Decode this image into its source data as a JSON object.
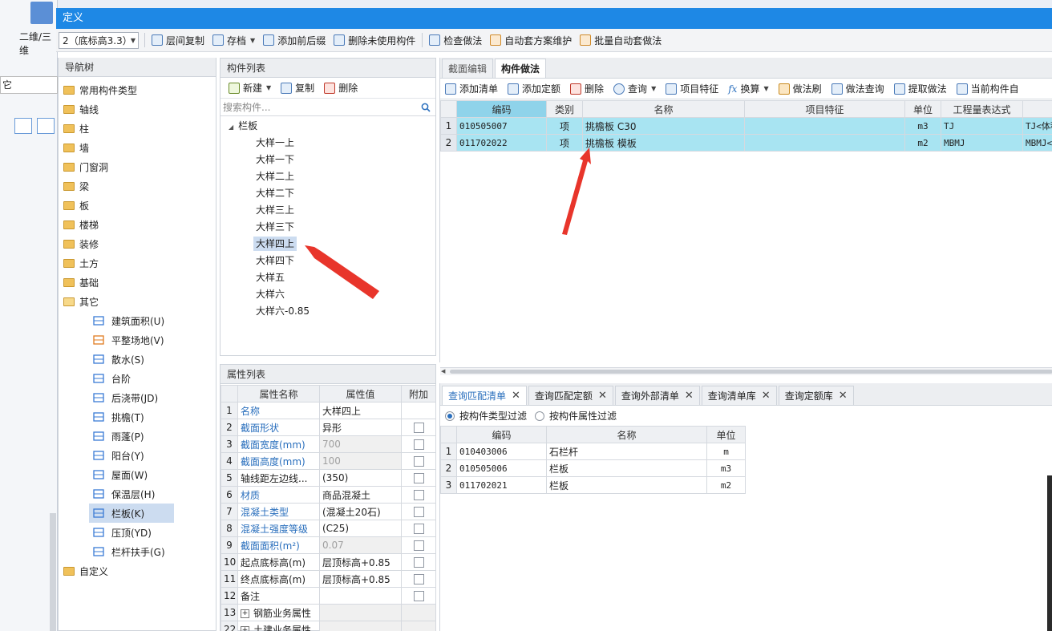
{
  "window": {
    "title": "定义"
  },
  "background_app": {
    "ribbon_label": "二维/三维",
    "left_combo": "它"
  },
  "toolbar": {
    "floor_select": "2（底标高3.3）",
    "items": [
      "层间复制",
      "存档",
      "添加前后缀",
      "删除未使用构件",
      "检查做法",
      "自动套方案维护",
      "批量自动套做法"
    ]
  },
  "nav_tree": {
    "title": "导航树",
    "items": [
      "常用构件类型",
      "轴线",
      "柱",
      "墙",
      "门窗洞",
      "梁",
      "板",
      "楼梯",
      "装修",
      "土方",
      "基础",
      "其它"
    ],
    "sub_items": [
      "建筑面积(U)",
      "平整场地(V)",
      "散水(S)",
      "台阶",
      "后浇带(JD)",
      "挑檐(T)",
      "雨蓬(P)",
      "阳台(Y)",
      "屋面(W)",
      "保温层(H)",
      "栏板(K)",
      "压顶(YD)",
      "栏杆扶手(G)"
    ],
    "last_item": "自定义",
    "selected": "栏板(K)"
  },
  "component_list": {
    "title": "构件列表",
    "new_label": "新建",
    "copy_label": "复制",
    "delete_label": "删除",
    "search_placeholder": "搜索构件...",
    "group": "栏板",
    "items": [
      "大样一上",
      "大样一下",
      "大样二上",
      "大样二下",
      "大样三上",
      "大样三下",
      "大样四上",
      "大样四下",
      "大样五",
      "大样六",
      "大样六-0.85"
    ],
    "selected": "大样四上"
  },
  "properties": {
    "title": "属性列表",
    "headers": [
      "属性名称",
      "属性值",
      "附加"
    ],
    "rows": [
      {
        "n": "1",
        "name": "名称",
        "value": "大样四上",
        "blue": true,
        "gray": false,
        "cb": false
      },
      {
        "n": "2",
        "name": "截面形状",
        "value": "异形",
        "blue": true,
        "gray": false,
        "cb": true
      },
      {
        "n": "3",
        "name": "截面宽度(mm)",
        "value": "700",
        "blue": true,
        "gray": true,
        "cb": true
      },
      {
        "n": "4",
        "name": "截面高度(mm)",
        "value": "100",
        "blue": true,
        "gray": true,
        "cb": true
      },
      {
        "n": "5",
        "name": "轴线距左边线...",
        "value": "(350)",
        "blue": false,
        "gray": false,
        "cb": true
      },
      {
        "n": "6",
        "name": "材质",
        "value": "商品混凝土",
        "blue": true,
        "gray": false,
        "cb": true
      },
      {
        "n": "7",
        "name": "混凝土类型",
        "value": "(混凝土20石)",
        "blue": true,
        "gray": false,
        "cb": true
      },
      {
        "n": "8",
        "name": "混凝土强度等级",
        "value": "(C25)",
        "blue": true,
        "gray": false,
        "cb": true
      },
      {
        "n": "9",
        "name": "截面面积(m²)",
        "value": "0.07",
        "blue": true,
        "gray": true,
        "cb": true
      },
      {
        "n": "10",
        "name": "起点底标高(m)",
        "value": "层顶标高+0.85",
        "blue": false,
        "gray": false,
        "cb": true
      },
      {
        "n": "11",
        "name": "终点底标高(m)",
        "value": "层顶标高+0.85",
        "blue": false,
        "gray": false,
        "cb": true
      },
      {
        "n": "12",
        "name": "备注",
        "value": "",
        "blue": false,
        "gray": false,
        "cb": true
      },
      {
        "n": "13",
        "name": "钢筋业务属性",
        "value": "",
        "blue": false,
        "gray": true,
        "cb": false,
        "expand": true
      },
      {
        "n": "22",
        "name": "土建业务属性",
        "value": "",
        "blue": false,
        "gray": true,
        "cb": false,
        "expand": true
      }
    ]
  },
  "method": {
    "tabs": [
      "截面编辑",
      "构件做法"
    ],
    "active_tab": "构件做法",
    "toolbar": [
      "添加清单",
      "添加定额",
      "删除",
      "查询",
      "项目特征",
      "换算",
      "做法刷",
      "做法查询",
      "提取做法",
      "当前构件自"
    ],
    "headers": [
      "编码",
      "类别",
      "名称",
      "项目特征",
      "单位",
      "工程量表达式",
      ""
    ],
    "rows": [
      {
        "n": "1",
        "code": "010505007",
        "type": "项",
        "name": "挑檐板 C30",
        "feature": "",
        "unit": "m3",
        "expr": "TJ",
        "extra": "TJ<体积"
      },
      {
        "n": "2",
        "code": "011702022",
        "type": "项",
        "name": "挑檐板 模板",
        "feature": "",
        "unit": "m2",
        "expr": "MBMJ",
        "extra": "MBMJ<模"
      }
    ]
  },
  "query": {
    "tabs": [
      "查询匹配清单",
      "查询匹配定额",
      "查询外部清单",
      "查询清单库",
      "查询定额库"
    ],
    "active_tab": "查询匹配清单",
    "filter_type": "按构件类型过滤",
    "filter_attr": "按构件属性过滤",
    "headers": [
      "编码",
      "名称",
      "单位"
    ],
    "rows": [
      {
        "n": "1",
        "code": "010403006",
        "name": "石栏杆",
        "unit": "m"
      },
      {
        "n": "2",
        "code": "010505006",
        "name": "栏板",
        "unit": "m3"
      },
      {
        "n": "3",
        "code": "011702021",
        "name": "栏板",
        "unit": "m2"
      }
    ]
  },
  "colors": {
    "titlebar": "#1e88e5",
    "highlight_row": "#a8e4f2",
    "arrow": "#e8352b",
    "selected": "#ccdcf0"
  }
}
